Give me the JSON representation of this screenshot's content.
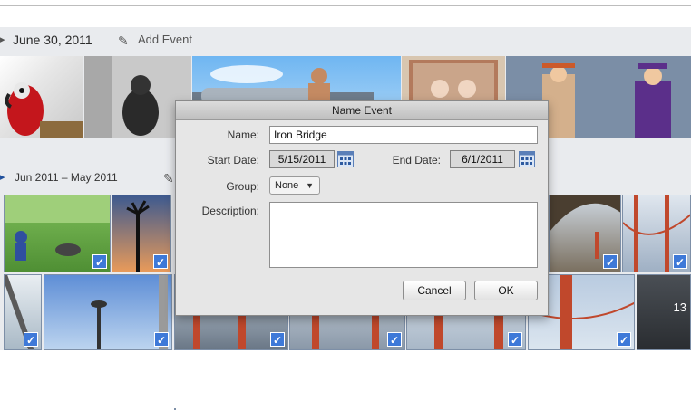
{
  "events_top": {
    "date_label": "June 30, 2011",
    "add_event_label": "Add Event"
  },
  "events_group": {
    "range_label": "Jun 2011 – May 2011",
    "photo_count_badge": "13"
  },
  "dialog": {
    "title": "Name Event",
    "name_label": "Name:",
    "name_value": "Iron Bridge",
    "start_date_label": "Start Date:",
    "start_date_value": "5/15/2011",
    "end_date_label": "End Date:",
    "end_date_value": "6/1/2011",
    "group_label": "Group:",
    "group_value": "None",
    "description_label": "Description:",
    "description_value": "",
    "cancel_label": "Cancel",
    "ok_label": "OK"
  },
  "icons": {
    "pencil": "pencil-icon",
    "calendar": "calendar-icon",
    "checkmark": "checkmark-icon",
    "disclosure": "disclosure-triangle-icon"
  },
  "colors": {
    "accent_blue": "#1f4f9c",
    "check_blue": "#3e79d8",
    "dialog_bg": "#e6e6e6"
  }
}
